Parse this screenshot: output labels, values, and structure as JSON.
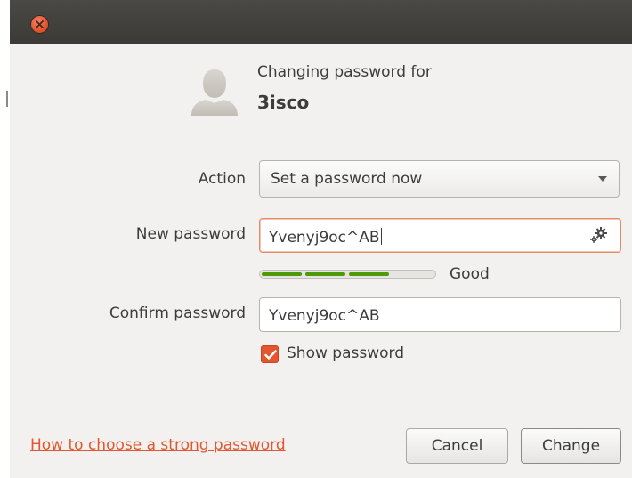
{
  "titlebar": {
    "close_icon": "close-icon"
  },
  "header": {
    "avatar_icon": "user-avatar-icon",
    "changing_label": "Changing password for",
    "username": "3isco"
  },
  "form": {
    "action_label": "Action",
    "action_value": "Set a password now",
    "new_password_label": "New password",
    "new_password_value": "Yvenyj9oc^AB",
    "generate_icon": "gear-icon",
    "strength_text": "Good",
    "strength_level": 0.75,
    "confirm_label": "Confirm password",
    "confirm_value": "Yvenyj9oc^AB",
    "show_password_label": "Show password",
    "show_password_checked": true
  },
  "footer": {
    "help_link": "How to choose a strong password",
    "cancel_label": "Cancel",
    "change_label": "Change"
  },
  "colors": {
    "accent": "#e2572e",
    "strength": "#4e9a06",
    "titlebar": "#3b3a36"
  }
}
